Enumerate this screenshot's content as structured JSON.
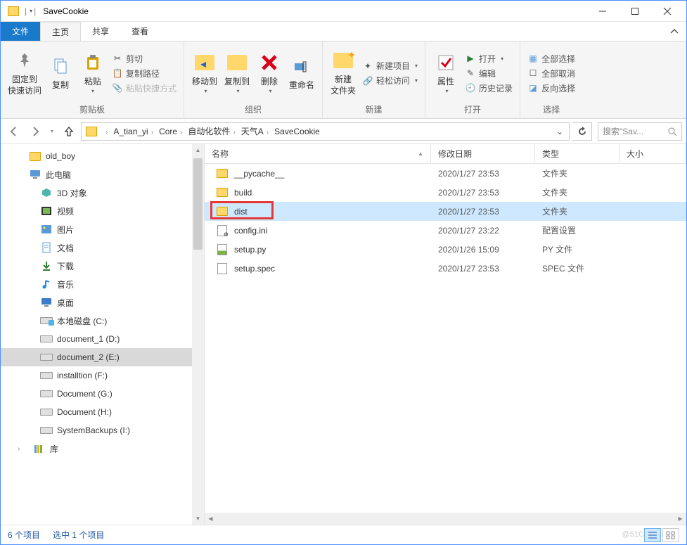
{
  "title": "SaveCookie",
  "tabs": {
    "file": "文件",
    "home": "主页",
    "share": "共享",
    "view": "查看"
  },
  "ribbon": {
    "clipboard": {
      "pin": "固定到\n快速访问",
      "copy": "复制",
      "paste": "粘贴",
      "cut": "剪切",
      "copypath": "复制路径",
      "pasteshortcut": "粘贴快捷方式",
      "label": "剪贴板"
    },
    "organize": {
      "moveto": "移动到",
      "copyto": "复制到",
      "delete": "删除",
      "rename": "重命名",
      "label": "组织"
    },
    "new": {
      "newfolder": "新建\n文件夹",
      "newitem": "新建项目",
      "easyaccess": "轻松访问",
      "label": "新建"
    },
    "open": {
      "properties": "属性",
      "open": "打开",
      "edit": "编辑",
      "history": "历史记录",
      "label": "打开"
    },
    "select": {
      "selectall": "全部选择",
      "selectnone": "全部取消",
      "invert": "反向选择",
      "label": "选择"
    }
  },
  "breadcrumb": [
    "A_tian_yi",
    "Core",
    "自动化软件",
    "天气A",
    "SaveCookie"
  ],
  "search_placeholder": "搜索\"Sav...",
  "tree": [
    {
      "name": "old_boy",
      "icon": "folder",
      "indent": false
    },
    {
      "name": "此电脑",
      "icon": "pc",
      "indent": false
    },
    {
      "name": "3D 对象",
      "icon": "3d",
      "indent": true
    },
    {
      "name": "视频",
      "icon": "video",
      "indent": true
    },
    {
      "name": "图片",
      "icon": "pic",
      "indent": true
    },
    {
      "name": "文档",
      "icon": "doc",
      "indent": true
    },
    {
      "name": "下载",
      "icon": "down",
      "indent": true
    },
    {
      "name": "音乐",
      "icon": "music",
      "indent": true
    },
    {
      "name": "桌面",
      "icon": "desktop",
      "indent": true
    },
    {
      "name": "本地磁盘 (C:)",
      "icon": "drive-c",
      "indent": true
    },
    {
      "name": "document_1 (D:)",
      "icon": "drive",
      "indent": true
    },
    {
      "name": "document_2 (E:)",
      "icon": "drive",
      "indent": true,
      "selected": true
    },
    {
      "name": "installtion (F:)",
      "icon": "drive",
      "indent": true
    },
    {
      "name": "Document (G:)",
      "icon": "drive",
      "indent": true
    },
    {
      "name": "Document (H:)",
      "icon": "drive",
      "indent": true
    },
    {
      "name": "SystemBackups (I:)",
      "icon": "drive",
      "indent": true
    },
    {
      "name": "库",
      "icon": "lib",
      "indent": false,
      "exp": true
    }
  ],
  "columns": {
    "name": "名称",
    "date": "修改日期",
    "type": "类型",
    "size": "大小"
  },
  "files": [
    {
      "name": "__pycache__",
      "date": "2020/1/27 23:53",
      "type": "文件夹",
      "icon": "folder"
    },
    {
      "name": "build",
      "date": "2020/1/27 23:53",
      "type": "文件夹",
      "icon": "folder"
    },
    {
      "name": "dist",
      "date": "2020/1/27 23:53",
      "type": "文件夹",
      "icon": "folder",
      "selected": true,
      "highlight": true
    },
    {
      "name": "config.ini",
      "date": "2020/1/27 23:22",
      "type": "配置设置",
      "icon": "ini"
    },
    {
      "name": "setup.py",
      "date": "2020/1/26 15:09",
      "type": "PY 文件",
      "icon": "py"
    },
    {
      "name": "setup.spec",
      "date": "2020/1/27 23:53",
      "type": "SPEC 文件",
      "icon": "file"
    }
  ],
  "status": {
    "count": "6 个项目",
    "selected": "选中 1 个项目"
  },
  "watermark": "@51C"
}
